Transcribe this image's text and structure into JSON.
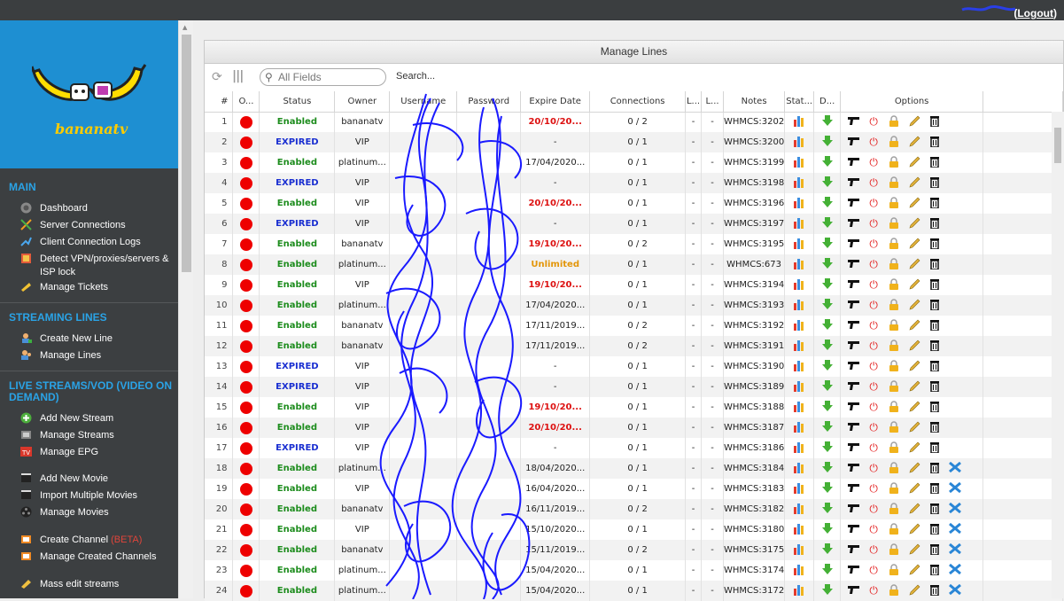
{
  "header": {
    "logout_label": "Logout"
  },
  "brand": {
    "name": "bananatv"
  },
  "sidebar": {
    "sections": [
      {
        "title": "MAIN",
        "items": [
          {
            "label": "Dashboard",
            "icon": "dashboard-icon"
          },
          {
            "label": "Server Connections",
            "icon": "connections-icon"
          },
          {
            "label": "Client Connection Logs",
            "icon": "logs-icon"
          },
          {
            "label": "Detect VPN/proxies/servers & ISP lock",
            "icon": "shield-icon"
          },
          {
            "label": "Manage Tickets",
            "icon": "ticket-icon"
          }
        ]
      },
      {
        "title": "STREAMING LINES",
        "items": [
          {
            "label": "Create New Line",
            "icon": "add-user-icon"
          },
          {
            "label": "Manage Lines",
            "icon": "users-icon"
          }
        ]
      },
      {
        "title": "LIVE STREAMS/VOD (VIDEO ON DEMAND)",
        "items": [
          {
            "label": "Add New Stream",
            "icon": "plus-icon"
          },
          {
            "label": "Manage Streams",
            "icon": "stream-icon"
          },
          {
            "label": "Manage EPG",
            "icon": "tv-icon"
          },
          {
            "label": "Add New Movie",
            "icon": "movie-add-icon"
          },
          {
            "label": "Import Multiple Movies",
            "icon": "movie-import-icon"
          },
          {
            "label": "Manage Movies",
            "icon": "film-icon"
          },
          {
            "label": "Create Channel",
            "icon": "channel-icon",
            "badge": "(BETA)"
          },
          {
            "label": "Manage Created Channels",
            "icon": "channels-icon"
          },
          {
            "label": "Mass edit streams",
            "icon": "mass-edit-icon"
          }
        ]
      }
    ]
  },
  "panel": {
    "title": "Manage Lines",
    "search": {
      "placeholder": "All Fields",
      "label": "Search..."
    },
    "columns": [
      "#",
      "O...",
      "Status",
      "Owner",
      "Username",
      "Password",
      "Expire Date",
      "Connections",
      "L...",
      "L...",
      "Notes",
      "Stat...",
      "D...",
      "Options"
    ],
    "rows": [
      {
        "n": "1",
        "status": "Enabled",
        "owner": "bananatv",
        "expire": "20/10/20...",
        "exp_style": "red",
        "conn": "0 / 2",
        "l1": "-",
        "l2": "-",
        "notes": "WHMCS:3202",
        "extra": false
      },
      {
        "n": "2",
        "status": "EXPIRED",
        "owner": "VIP",
        "expire": "-",
        "exp_style": "plain",
        "conn": "0 / 1",
        "l1": "-",
        "l2": "-",
        "notes": "WHMCS:3200",
        "extra": false
      },
      {
        "n": "3",
        "status": "Enabled",
        "owner": "platinum...",
        "expire": "17/04/2020...",
        "exp_style": "plain",
        "conn": "0 / 1",
        "l1": "-",
        "l2": "-",
        "notes": "WHMCS:3199",
        "extra": false
      },
      {
        "n": "4",
        "status": "EXPIRED",
        "owner": "VIP",
        "expire": "-",
        "exp_style": "plain",
        "conn": "0 / 1",
        "l1": "-",
        "l2": "-",
        "notes": "WHMCS:3198",
        "extra": false
      },
      {
        "n": "5",
        "status": "Enabled",
        "owner": "VIP",
        "expire": "20/10/20...",
        "exp_style": "red",
        "conn": "0 / 1",
        "l1": "-",
        "l2": "-",
        "notes": "WHMCS:3196",
        "extra": false
      },
      {
        "n": "6",
        "status": "EXPIRED",
        "owner": "VIP",
        "expire": "-",
        "exp_style": "plain",
        "conn": "0 / 1",
        "l1": "-",
        "l2": "-",
        "notes": "WHMCS:3197",
        "extra": false
      },
      {
        "n": "7",
        "status": "Enabled",
        "owner": "bananatv",
        "expire": "19/10/20...",
        "exp_style": "red",
        "conn": "0 / 2",
        "l1": "-",
        "l2": "-",
        "notes": "WHMCS:3195",
        "extra": false
      },
      {
        "n": "8",
        "status": "Enabled",
        "owner": "platinum...",
        "expire": "Unlimited",
        "exp_style": "unlimited",
        "conn": "0 / 1",
        "l1": "-",
        "l2": "-",
        "notes": "WHMCS:673",
        "extra": false
      },
      {
        "n": "9",
        "status": "Enabled",
        "owner": "VIP",
        "expire": "19/10/20...",
        "exp_style": "red",
        "conn": "0 / 1",
        "l1": "-",
        "l2": "-",
        "notes": "WHMCS:3194",
        "extra": false
      },
      {
        "n": "10",
        "status": "Enabled",
        "owner": "platinum...",
        "expire": "17/04/2020...",
        "exp_style": "plain",
        "conn": "0 / 1",
        "l1": "-",
        "l2": "-",
        "notes": "WHMCS:3193",
        "extra": false
      },
      {
        "n": "11",
        "status": "Enabled",
        "owner": "bananatv",
        "expire": "17/11/2019...",
        "exp_style": "plain",
        "conn": "0 / 2",
        "l1": "-",
        "l2": "-",
        "notes": "WHMCS:3192",
        "extra": false
      },
      {
        "n": "12",
        "status": "Enabled",
        "owner": "bananatv",
        "expire": "17/11/2019...",
        "exp_style": "plain",
        "conn": "0 / 2",
        "l1": "-",
        "l2": "-",
        "notes": "WHMCS:3191",
        "extra": false
      },
      {
        "n": "13",
        "status": "EXPIRED",
        "owner": "VIP",
        "expire": "-",
        "exp_style": "plain",
        "conn": "0 / 1",
        "l1": "-",
        "l2": "-",
        "notes": "WHMCS:3190",
        "extra": false
      },
      {
        "n": "14",
        "status": "EXPIRED",
        "owner": "VIP",
        "expire": "-",
        "exp_style": "plain",
        "conn": "0 / 1",
        "l1": "-",
        "l2": "-",
        "notes": "WHMCS:3189",
        "extra": false
      },
      {
        "n": "15",
        "status": "Enabled",
        "owner": "VIP",
        "expire": "19/10/20...",
        "exp_style": "red",
        "conn": "0 / 1",
        "l1": "-",
        "l2": "-",
        "notes": "WHMCS:3188",
        "extra": false
      },
      {
        "n": "16",
        "status": "Enabled",
        "owner": "VIP",
        "expire": "20/10/20...",
        "exp_style": "red",
        "conn": "0 / 1",
        "l1": "-",
        "l2": "-",
        "notes": "WHMCS:3187",
        "extra": false
      },
      {
        "n": "17",
        "status": "EXPIRED",
        "owner": "VIP",
        "expire": "-",
        "exp_style": "plain",
        "conn": "0 / 1",
        "l1": "-",
        "l2": "-",
        "notes": "WHMCS:3186",
        "extra": false
      },
      {
        "n": "18",
        "status": "Enabled",
        "owner": "platinum...",
        "expire": "18/04/2020...",
        "exp_style": "plain",
        "conn": "0 / 1",
        "l1": "-",
        "l2": "-",
        "notes": "WHMCS:3184",
        "extra": true
      },
      {
        "n": "19",
        "status": "Enabled",
        "owner": "VIP",
        "expire": "16/04/2020...",
        "exp_style": "plain",
        "conn": "0 / 1",
        "l1": "-",
        "l2": "-",
        "notes": "WHMCS:3183",
        "extra": true
      },
      {
        "n": "20",
        "status": "Enabled",
        "owner": "bananatv",
        "expire": "16/11/2019...",
        "exp_style": "plain",
        "conn": "0 / 2",
        "l1": "-",
        "l2": "-",
        "notes": "WHMCS:3182",
        "extra": true
      },
      {
        "n": "21",
        "status": "Enabled",
        "owner": "VIP",
        "expire": "15/10/2020...",
        "exp_style": "plain",
        "conn": "0 / 1",
        "l1": "-",
        "l2": "-",
        "notes": "WHMCS:3180",
        "extra": true
      },
      {
        "n": "22",
        "status": "Enabled",
        "owner": "bananatv",
        "expire": "15/11/2019...",
        "exp_style": "plain",
        "conn": "0 / 2",
        "l1": "-",
        "l2": "-",
        "notes": "WHMCS:3175",
        "extra": true
      },
      {
        "n": "23",
        "status": "Enabled",
        "owner": "platinum...",
        "expire": "15/04/2020...",
        "exp_style": "plain",
        "conn": "0 / 1",
        "l1": "-",
        "l2": "-",
        "notes": "WHMCS:3174",
        "extra": true
      },
      {
        "n": "24",
        "status": "Enabled",
        "owner": "platinum...",
        "expire": "15/04/2020...",
        "exp_style": "plain",
        "conn": "0 / 1",
        "l1": "-",
        "l2": "-",
        "notes": "WHMCS:3172",
        "extra": true
      }
    ]
  },
  "colors": {
    "sidebar_bg": "#3c3f41",
    "logo_bg": "#1e8fd2",
    "section_title": "#2aa3e6",
    "enabled": "#1d8c1d",
    "expired": "#1a2fd1",
    "expire_red": "#dd1111",
    "unlimited": "#e3960a",
    "scribble": "#1a1aff"
  }
}
